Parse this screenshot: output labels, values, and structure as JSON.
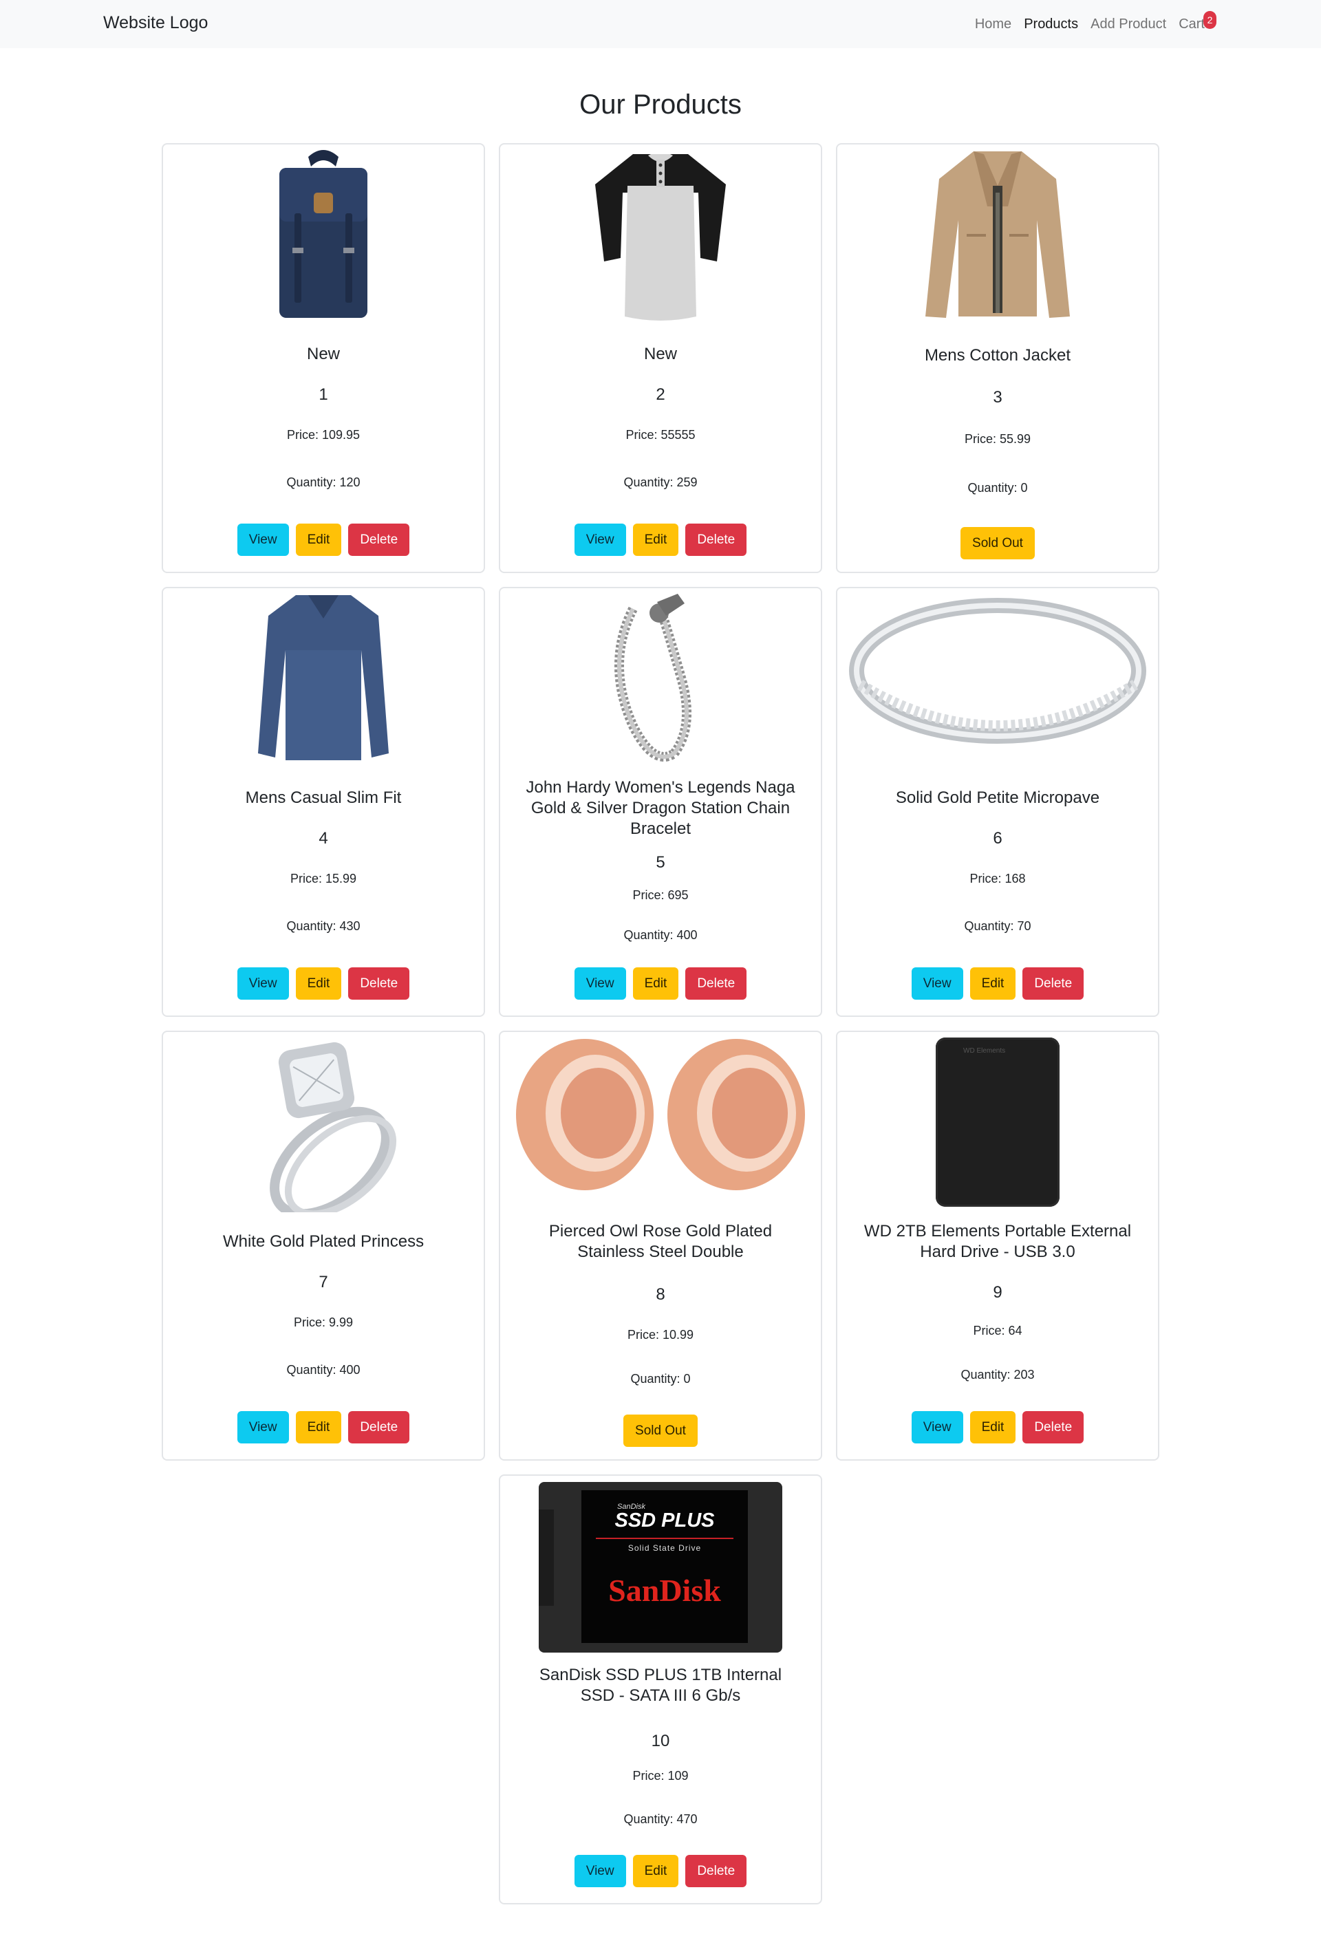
{
  "navbar": {
    "brand": "Website Logo",
    "links": [
      "Home",
      "Products",
      "Add Product",
      "Cart"
    ],
    "cart_count": "2"
  },
  "title": "Our Products",
  "buttons": {
    "view": "View",
    "edit": "Edit",
    "delete": "Delete",
    "sold_out": "Sold Out"
  },
  "products": [
    {
      "name": "New",
      "id": "1",
      "price": "Price: 109.95",
      "quantity": "Quantity: 120",
      "image": "backpack-image"
    },
    {
      "name": "New",
      "id": "2",
      "price": "Price: 55555",
      "quantity": "Quantity: 259",
      "image": "raglan-shirt-image"
    },
    {
      "name": "Mens Cotton Jacket",
      "id": "3",
      "price": "Price: 55.99",
      "quantity": "Quantity: 0",
      "image": "jacket-image"
    },
    {
      "name": "Mens Casual Slim Fit",
      "id": "4",
      "price": "Price: 15.99",
      "quantity": "Quantity: 430",
      "image": "long-sleeve-shirt-image"
    },
    {
      "name": "John Hardy Women's Legends Naga Gold & Silver Dragon Station Chain Bracelet",
      "id": "5",
      "price": "Price: 695",
      "quantity": "Quantity: 400",
      "image": "bracelet-image"
    },
    {
      "name": "Solid Gold Petite Micropave",
      "id": "6",
      "price": "Price: 168",
      "quantity": "Quantity: 70",
      "image": "ring-band-image"
    },
    {
      "name": "White Gold Plated Princess",
      "id": "7",
      "price": "Price: 9.99",
      "quantity": "Quantity: 400",
      "image": "diamond-ring-image"
    },
    {
      "name": "Pierced Owl Rose Gold Plated Stainless Steel Double",
      "id": "8",
      "price": "Price: 10.99",
      "quantity": "Quantity: 0",
      "image": "rose-gold-plugs-image"
    },
    {
      "name": "WD 2TB Elements Portable External Hard Drive - USB 3.0",
      "id": "9",
      "price": "Price: 64",
      "quantity": "Quantity: 203",
      "image": "hard-drive-image"
    },
    {
      "name": "SanDisk SSD PLUS 1TB Internal SSD - SATA III 6 Gb/s",
      "id": "10",
      "price": "Price: 109",
      "quantity": "Quantity: 470",
      "image": "ssd-image"
    }
  ],
  "ssd_label": {
    "brand_small": "SanDisk",
    "product": "SSD PLUS",
    "sub": "Solid State Drive",
    "logo": "SanDisk"
  },
  "hdd_label": "WD Elements"
}
